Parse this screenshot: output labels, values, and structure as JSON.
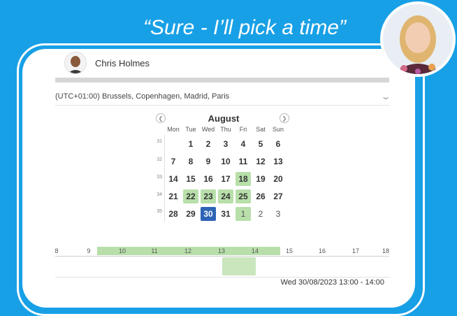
{
  "quote": "“Sure - I’ll pick a time”",
  "host": {
    "name": "Chris Holmes"
  },
  "timezone": {
    "label": "(UTC+01:00) Brussels, Copenhagen, Madrid, Paris"
  },
  "calendar": {
    "month": "August",
    "weekdays": [
      "Mon",
      "Tue",
      "Wed",
      "Thu",
      "Fri",
      "Sat",
      "Sun"
    ],
    "weeks": [
      {
        "num": "31",
        "days": [
          "",
          "1",
          "2",
          "3",
          "4",
          "5",
          "6"
        ]
      },
      {
        "num": "32",
        "days": [
          "7",
          "8",
          "9",
          "10",
          "11",
          "12",
          "13"
        ]
      },
      {
        "num": "33",
        "days": [
          "14",
          "15",
          "16",
          "17",
          "18",
          "19",
          "20"
        ]
      },
      {
        "num": "34",
        "days": [
          "21",
          "22",
          "23",
          "24",
          "25",
          "26",
          "27"
        ]
      },
      {
        "num": "35",
        "days": [
          "28",
          "29",
          "30",
          "31",
          "1",
          "2",
          "3"
        ]
      }
    ],
    "available_days": [
      "18",
      "22",
      "23",
      "24",
      "25",
      "1 Sep"
    ],
    "selected_day": "30"
  },
  "timeline": {
    "hours": [
      "8",
      "9",
      "10",
      "11",
      "12",
      "13",
      "14",
      "15",
      "16",
      "17",
      "18"
    ],
    "available_range": [
      "10",
      "14"
    ],
    "selected_slot": [
      "13:00",
      "14:00"
    ]
  },
  "selection_text": "Wed 30/08/2023 13:00 - 14:00",
  "colors": {
    "background": "#18a0e6",
    "available": "#b8dfaa",
    "selected": "#2f64b5"
  }
}
